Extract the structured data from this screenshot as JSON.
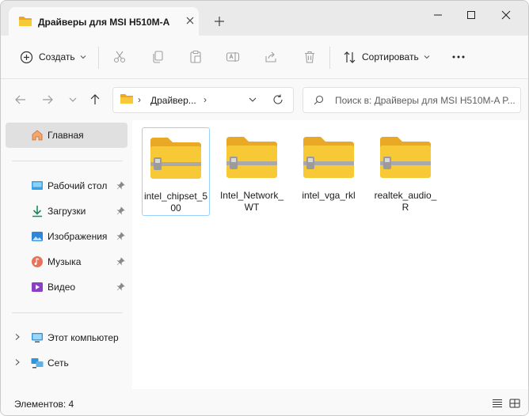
{
  "window": {
    "tab_title": "Драйверы для MSI H510M-A",
    "controls": {
      "minimize": "minimize",
      "maximize": "maximize",
      "close": "close"
    }
  },
  "toolbar": {
    "create_label": "Создать",
    "sort_label": "Сортировать",
    "icons": [
      "cut-icon",
      "copy-icon",
      "paste-icon",
      "rename-icon",
      "share-icon",
      "delete-icon",
      "more-icon"
    ]
  },
  "address": {
    "crumb": "Драйвер...",
    "search_placeholder": "Поиск в: Драйверы для MSI H510M-A P..."
  },
  "sidebar": {
    "home_label": "Главная",
    "quick_access": [
      {
        "label": "Рабочий стол",
        "icon": "desktop-icon",
        "pinned": true
      },
      {
        "label": "Загрузки",
        "icon": "downloads-icon",
        "pinned": true
      },
      {
        "label": "Изображения",
        "icon": "pictures-icon",
        "pinned": true
      },
      {
        "label": "Музыка",
        "icon": "music-icon",
        "pinned": true
      },
      {
        "label": "Видео",
        "icon": "videos-icon",
        "pinned": true
      }
    ],
    "this_pc_label": "Этот компьютер",
    "network_label": "Сеть"
  },
  "files": [
    {
      "name": "intel_chipset_500",
      "type": "compressed-folder",
      "selected": true
    },
    {
      "name": "Intel_Network_WT",
      "type": "compressed-folder",
      "selected": false
    },
    {
      "name": "intel_vga_rkl",
      "type": "compressed-folder",
      "selected": false
    },
    {
      "name": "realtek_audio_R",
      "type": "compressed-folder",
      "selected": false
    }
  ],
  "status": {
    "items_count": "Элементов: 4"
  },
  "colors": {
    "accent": "#0067c0",
    "folder_yellow": "#f8c936",
    "folder_dark": "#e9a825",
    "selection_border": "#99d1ff"
  }
}
